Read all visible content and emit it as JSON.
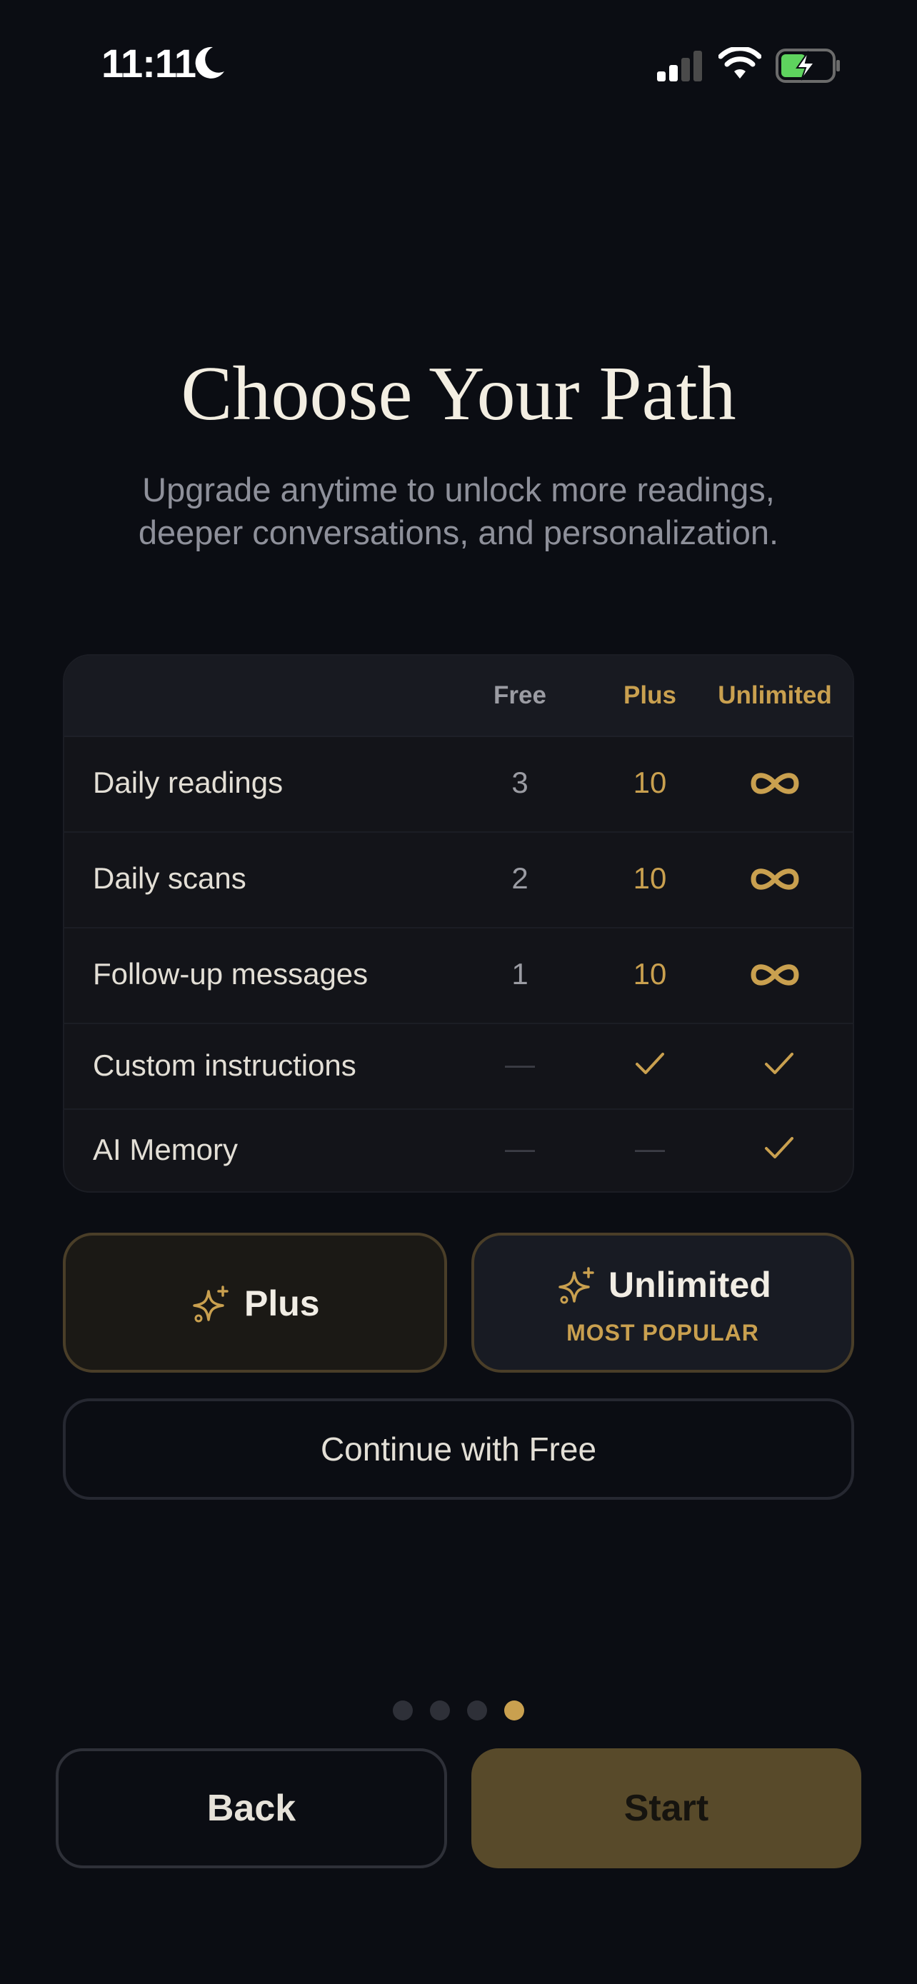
{
  "status_bar": {
    "time": "11:11",
    "icons": [
      "moon-icon",
      "cellular-signal-icon",
      "wifi-icon",
      "battery-charging-icon"
    ]
  },
  "title": "Choose Your Path",
  "subtitle": "Upgrade anytime to unlock more readings, deeper conversations, and personalization.",
  "table": {
    "headers": [
      "Free",
      "Plus",
      "Unlimited"
    ],
    "rows": [
      {
        "label": "Daily readings",
        "free": "3",
        "plus": "10",
        "unlimited": "∞"
      },
      {
        "label": "Daily scans",
        "free": "2",
        "plus": "10",
        "unlimited": "∞"
      },
      {
        "label": "Follow-up messages",
        "free": "1",
        "plus": "10",
        "unlimited": "∞"
      },
      {
        "label": "Custom instructions",
        "free": "—",
        "plus": "✓",
        "unlimited": "✓"
      },
      {
        "label": "AI Memory",
        "free": "—",
        "plus": "—",
        "unlimited": "✓"
      }
    ]
  },
  "plans": {
    "plus": {
      "label": "Plus",
      "icon": "sparkles-icon"
    },
    "unlimited": {
      "label": "Unlimited",
      "badge": "MOST POPULAR",
      "icon": "sparkles-icon"
    }
  },
  "continue_free": "Continue with Free",
  "pagination": {
    "total": 4,
    "current": 4
  },
  "nav": {
    "back": "Back",
    "start": "Start"
  },
  "colors": {
    "background": "#0b0d13",
    "accent": "#c9a04f",
    "start_button": "#584a2a"
  }
}
